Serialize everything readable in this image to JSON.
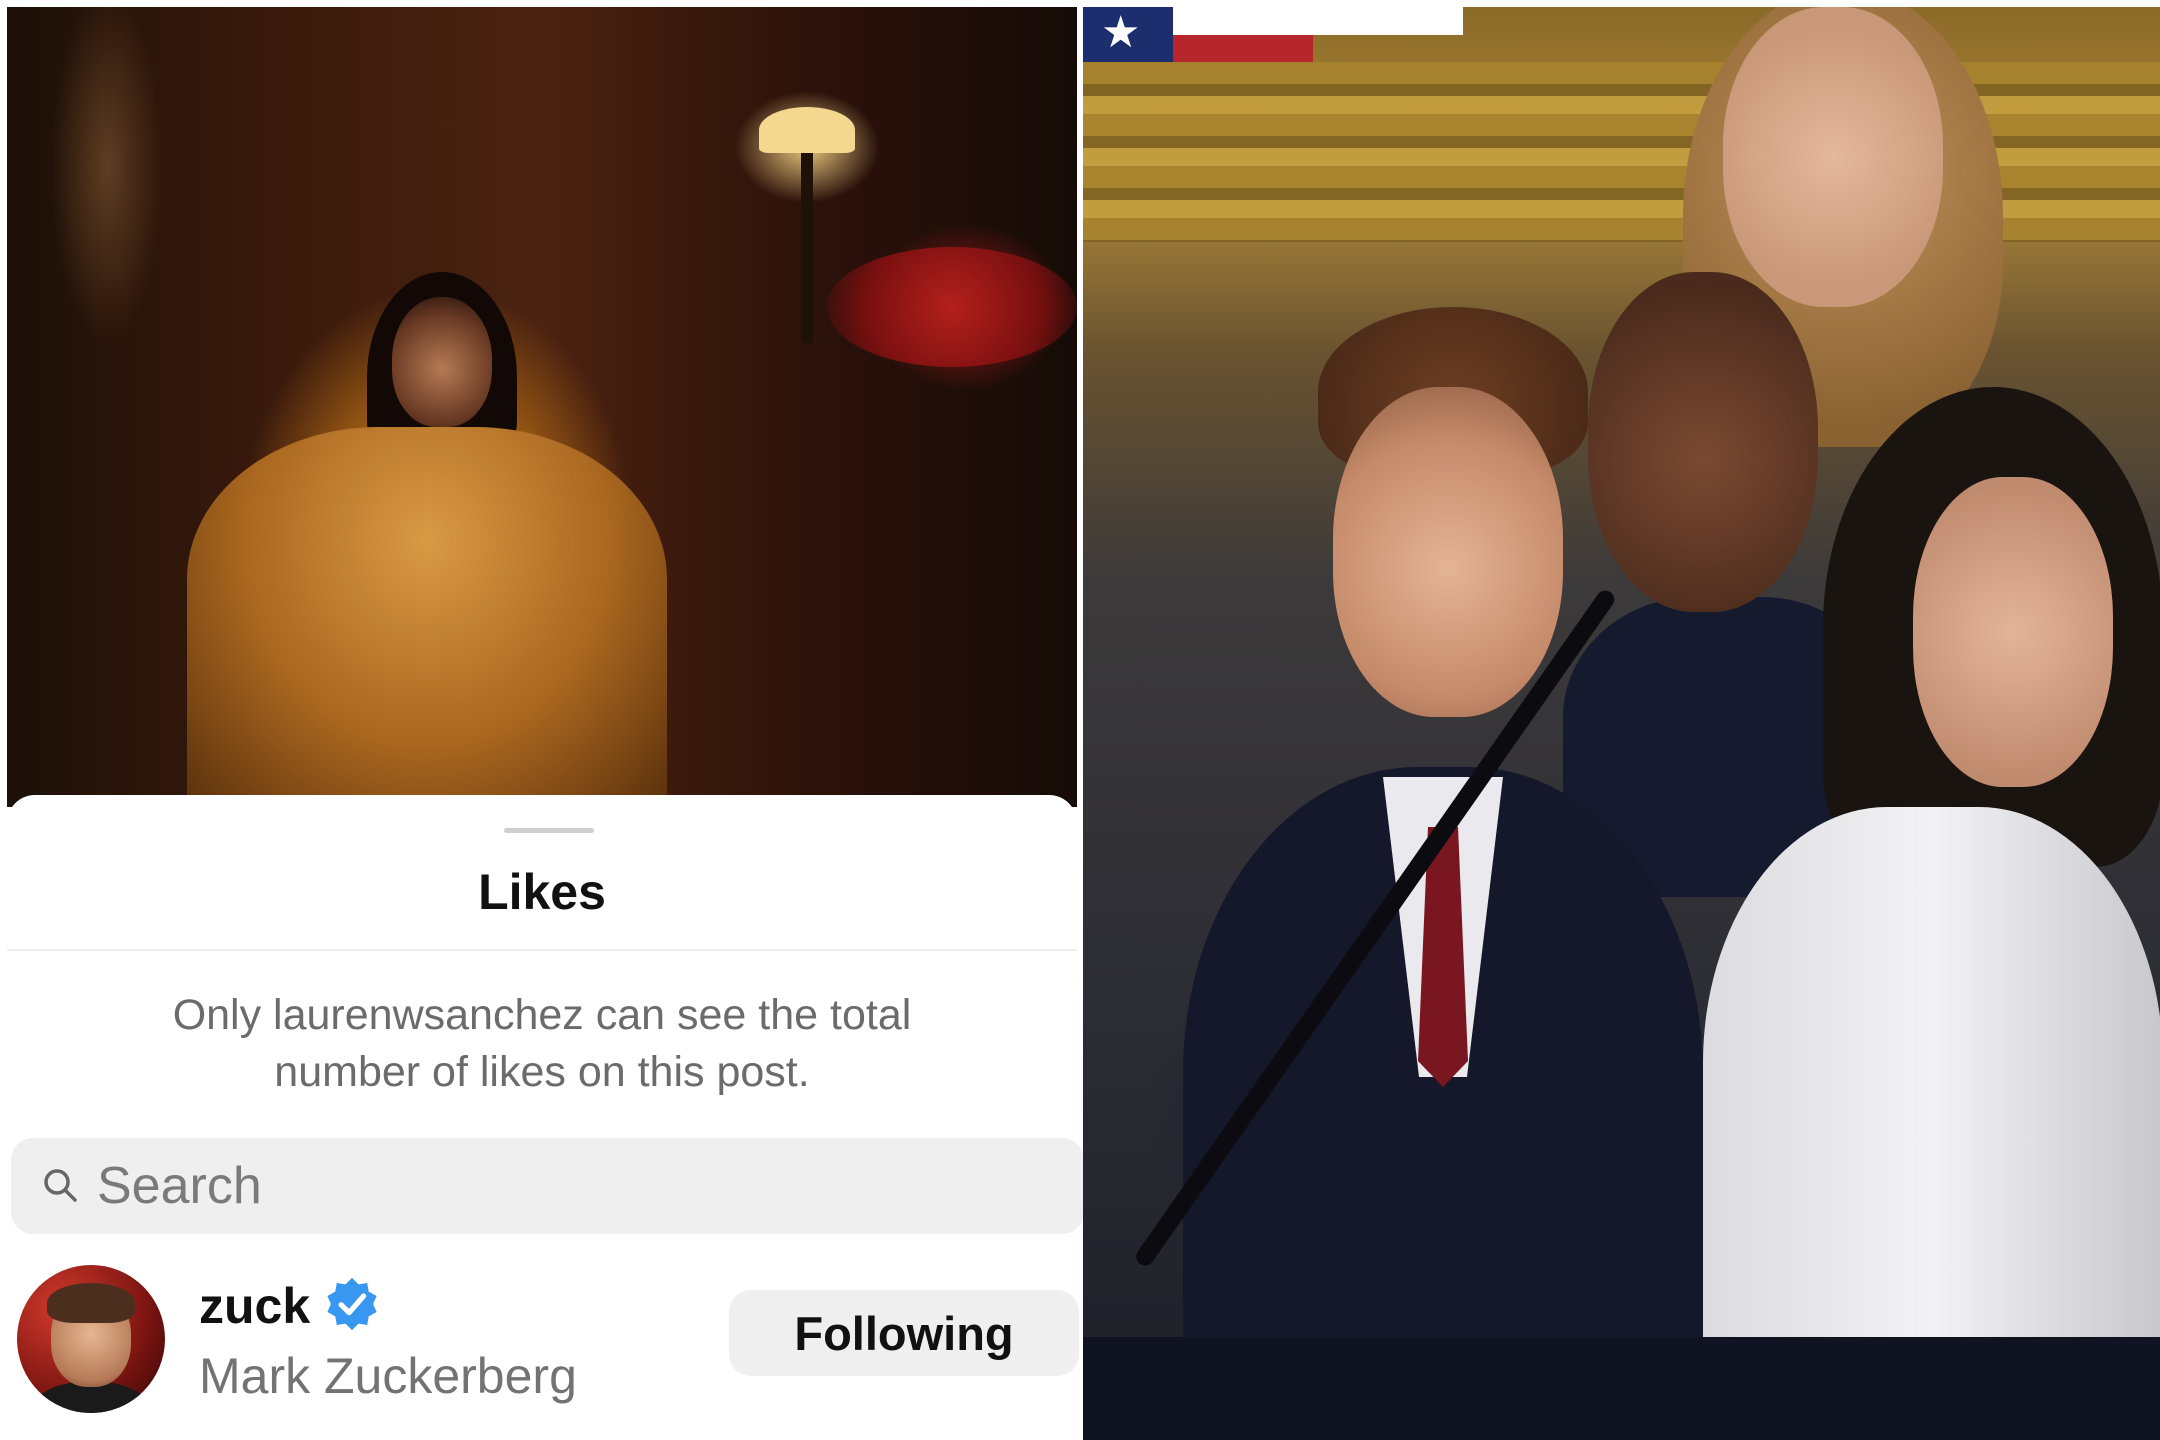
{
  "likes_sheet": {
    "title": "Likes",
    "notice": "Only laurenwsanchez can see the total number of likes on this post.",
    "search": {
      "placeholder": "Search"
    },
    "users": [
      {
        "username": "zuck",
        "full_name": "Mark Zuckerberg",
        "verified": true,
        "action_label": "Following"
      }
    ]
  },
  "colors": {
    "verified_badge": "#3897f0",
    "button_bg": "#efefef",
    "secondary_text": "#737373"
  }
}
